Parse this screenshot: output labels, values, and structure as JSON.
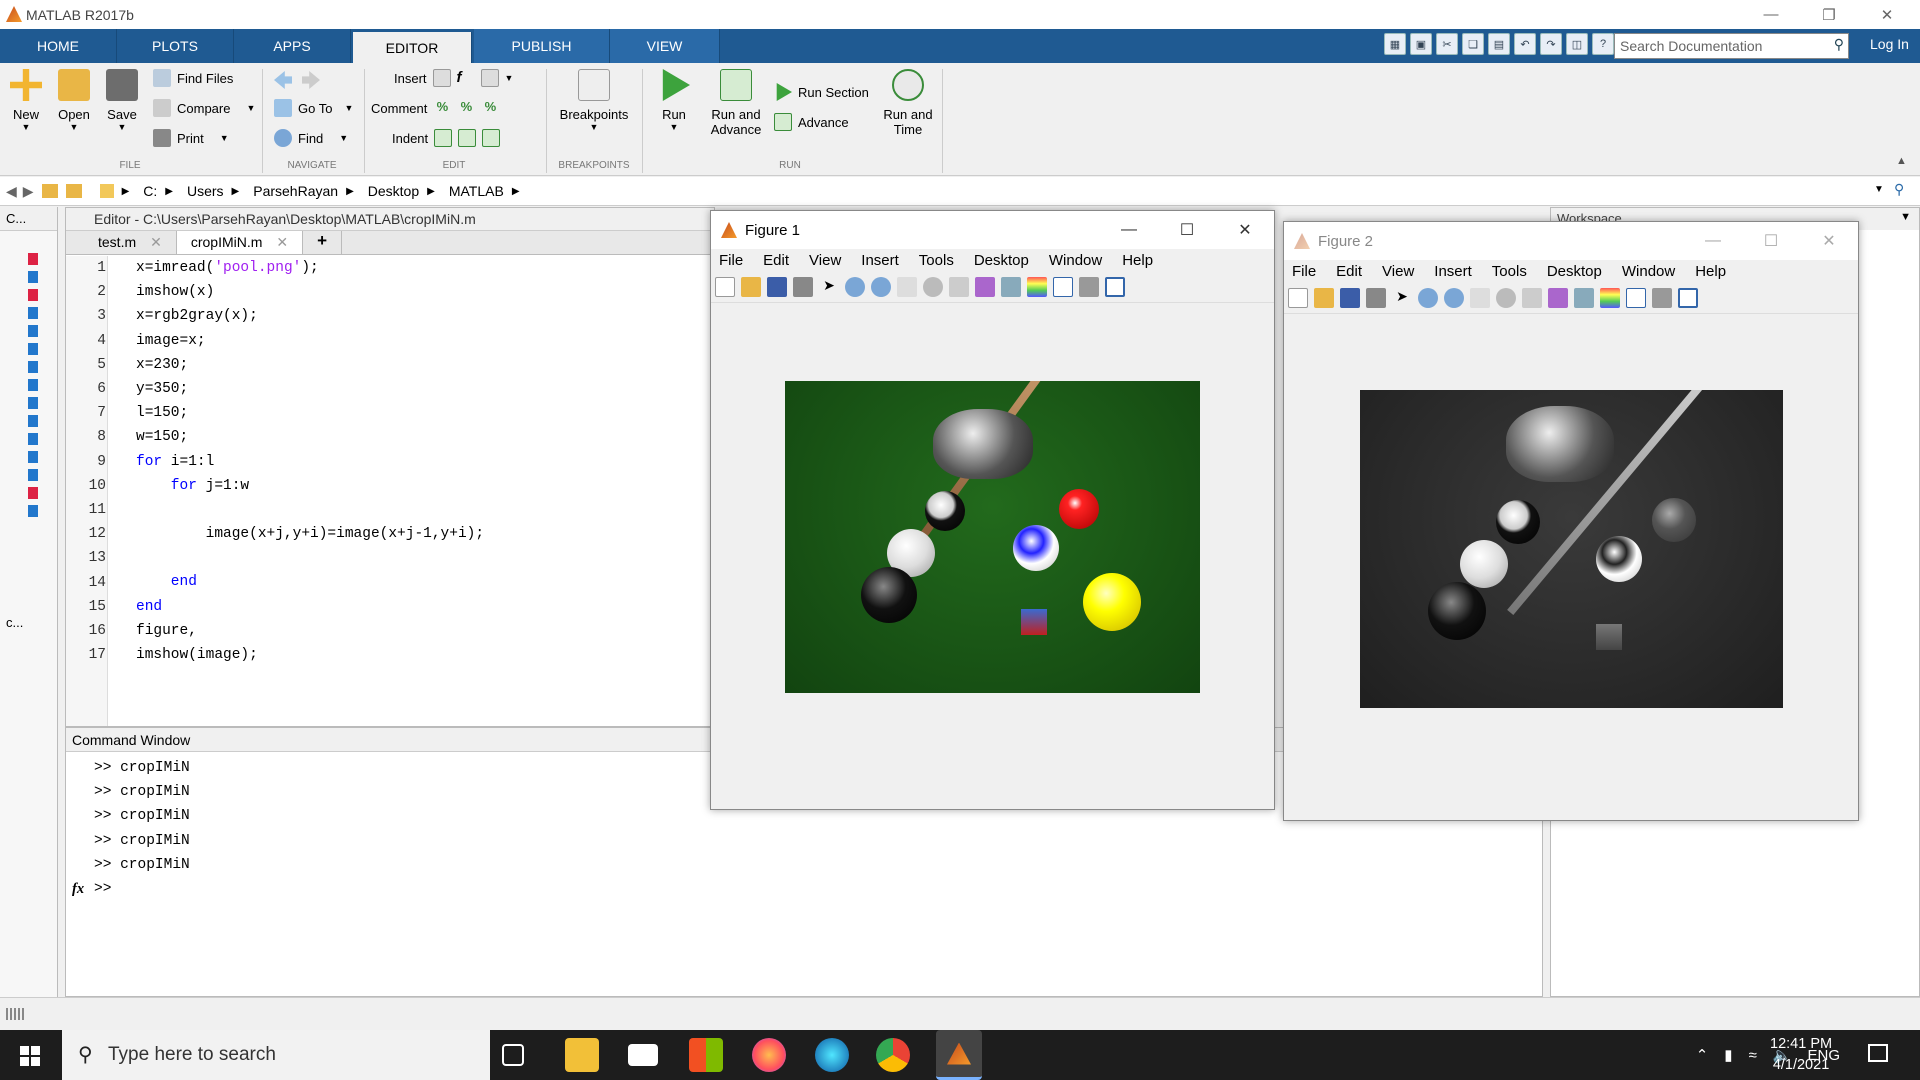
{
  "app": {
    "title": "MATLAB R2017b"
  },
  "ribbon_tabs": [
    "HOME",
    "PLOTS",
    "APPS",
    "EDITOR",
    "PUBLISH",
    "VIEW"
  ],
  "active_tab": "EDITOR",
  "search": {
    "placeholder": "Search Documentation"
  },
  "login": "Log In",
  "ribbon": {
    "file": {
      "new": "New",
      "open": "Open",
      "save": "Save",
      "find_files": "Find Files",
      "compare": "Compare",
      "print": "Print",
      "group": "FILE"
    },
    "navigate": {
      "goto": "Go To",
      "find": "Find",
      "group": "NAVIGATE"
    },
    "edit": {
      "insert": "Insert",
      "comment": "Comment",
      "indent": "Indent",
      "group": "EDIT"
    },
    "breakpoints": {
      "label": "Breakpoints",
      "group": "BREAKPOINTS"
    },
    "run": {
      "run": "Run",
      "run_advance_1": "Run and",
      "run_advance_2": "Advance",
      "run_section": "Run Section",
      "advance": "Advance",
      "run_time_1": "Run and",
      "run_time_2": "Time",
      "group": "RUN"
    }
  },
  "address": [
    "C:",
    "Users",
    "ParsehRayan",
    "Desktop",
    "MATLAB"
  ],
  "left_pane": {
    "label": "C...",
    "label2": "c..."
  },
  "editor": {
    "header": "Editor - C:\\Users\\ParsehRayan\\Desktop\\MATLAB\\cropIMiN.m",
    "tabs": [
      "test.m",
      "cropIMiN.m"
    ],
    "add_tab": "+",
    "line_numbers": [
      "1",
      "2",
      "3",
      "4",
      "5",
      "6",
      "7",
      "8",
      "9",
      "10",
      "11",
      "12",
      "13",
      "14",
      "15",
      "16",
      "17"
    ],
    "lines": [
      {
        "a": "x=imread(",
        "s": "'pool.png'",
        "b": ");"
      },
      {
        "a": "imshow(x)"
      },
      {
        "a": "x=rgb2gray(x);"
      },
      {
        "a": "image=x;"
      },
      {
        "a": "x=230;"
      },
      {
        "a": "y=350;"
      },
      {
        "a": "l=150;"
      },
      {
        "a": "w=150;"
      },
      {
        "k": "for",
        "a": " i=1:l"
      },
      {
        "k": "    for",
        "a": " j=1:w"
      },
      {
        "a": ""
      },
      {
        "a": "        image(x+j,y+i)=image(x+j-1,y+i);"
      },
      {
        "a": ""
      },
      {
        "k": "    end",
        "a": ""
      },
      {
        "k": "end",
        "a": ""
      },
      {
        "a": "figure,"
      },
      {
        "a": "imshow(image);"
      }
    ]
  },
  "command_window": {
    "title": "Command Window",
    "history": [
      ">>  cropIMiN",
      ">>  cropIMiN",
      ">>  cropIMiN",
      ">>  cropIMiN",
      ">>  cropIMiN"
    ],
    "prompt": ">>",
    "fx": "fx"
  },
  "workspace": {
    "title": "Workspace"
  },
  "figure1": {
    "title": "Figure 1",
    "menu": [
      "File",
      "Edit",
      "View",
      "Insert",
      "Tools",
      "Desktop",
      "Window",
      "Help"
    ]
  },
  "figure2": {
    "title": "Figure 2",
    "menu": [
      "File",
      "Edit",
      "View",
      "Insert",
      "Tools",
      "Desktop",
      "Window",
      "Help"
    ]
  },
  "taskbar": {
    "search": "Type here to search",
    "lang": "ENG",
    "time": "12:41 PM",
    "date": "4/1/2021"
  },
  "colors": {
    "tab_strip": "#1f5a92",
    "table_green": "#1a5a14",
    "table_gray": "#2b2b2b",
    "taskbar": "#1d1d1d"
  }
}
